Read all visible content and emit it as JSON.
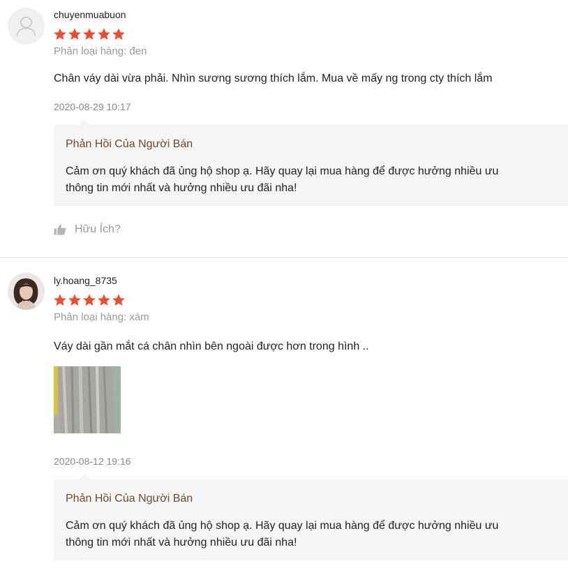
{
  "reviews": [
    {
      "username": "chuyenmuabuon",
      "rating": 5,
      "variation": "Phân loại hàng: đen",
      "content": "Chân váy dài vừa phải. Nhìn sương sương thích lắm. Mua về mấy ng trong cty thích lắm",
      "timestamp": "2020-08-29 10:17",
      "reply": {
        "title": "Phản Hồi Của Người Bán",
        "line1": "Cảm ơn quý khách đã ủng hộ shop ạ. Hãy quay lại mua hàng để được hưởng nhiều ưu",
        "line2": "thông tin mới nhất và hưởng nhiều ưu đãi nha!"
      },
      "helpful_label": "Hữu Ích?"
    },
    {
      "username": "ly.hoang_8735",
      "rating": 5,
      "variation": "Phân loại hàng: xám",
      "content": "Váy dài gần mắt cá chân nhìn bên ngoài được hơn trong hình ..",
      "timestamp": "2020-08-12 19:16",
      "reply": {
        "title": "Phản Hồi Của Người Bán",
        "line1": "Cảm ơn quý khách đã ủng hộ shop ạ. Hãy quay lại mua hàng để được hưởng nhiều ưu",
        "line2": "thông tin mới nhất và hưởng nhiều ưu đãi nha!"
      }
    }
  ],
  "colors": {
    "star": "#ee4d2d",
    "reply_title": "#6b4a2e",
    "reply_bg": "#f5f5f5",
    "muted_text": "#999999"
  },
  "icons": {
    "default_avatar": "user-outline-icon",
    "star": "star-icon",
    "helpful": "thumbs-up-icon"
  }
}
